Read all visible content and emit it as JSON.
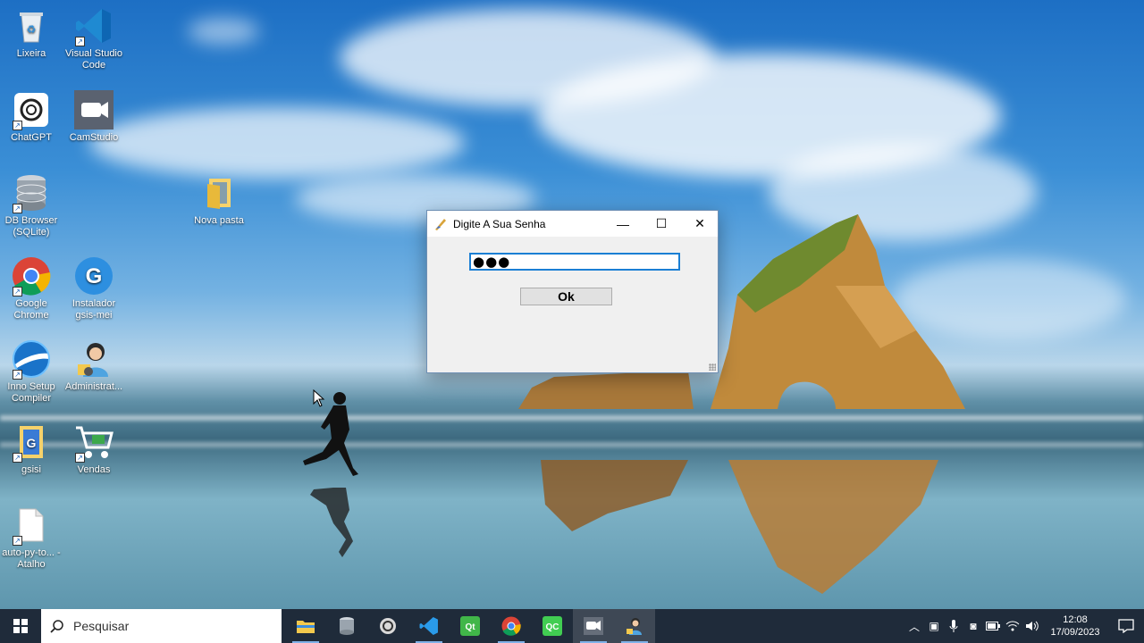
{
  "desktop": {
    "icons": [
      {
        "label": "Lixeira"
      },
      {
        "label": "Visual Studio Code"
      },
      {
        "label": "ChatGPT"
      },
      {
        "label": "CamStudio"
      },
      {
        "label": "DB Browser (SQLite)"
      },
      {
        "label": "Nova pasta"
      },
      {
        "label": "Google Chrome"
      },
      {
        "label": "Instalador gsis-mei"
      },
      {
        "label": "Inno Setup Compiler"
      },
      {
        "label": "Administrat..."
      },
      {
        "label": "gsisi"
      },
      {
        "label": "Vendas"
      },
      {
        "label": "auto-py-to... - Atalho"
      }
    ]
  },
  "dialog": {
    "title": "Digite A Sua Senha",
    "password_mask": "●●●",
    "ok_label": "Ok",
    "controls": {
      "minimize": "—",
      "maximize": "☐",
      "close": "✕"
    }
  },
  "taskbar": {
    "search_placeholder": "Pesquisar",
    "clock_time": "12:08",
    "clock_date": "17/09/2023"
  },
  "colors": {
    "taskbar_bg": "#1f2b3a",
    "focus_border": "#1b7fd4",
    "dialog_bg": "#f0f0f0"
  }
}
